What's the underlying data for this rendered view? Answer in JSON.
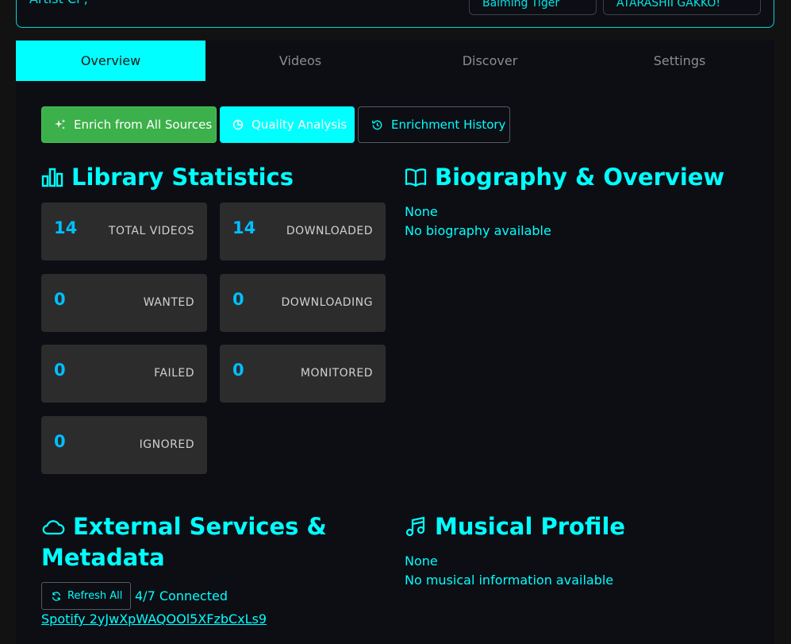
{
  "header": {
    "title_fragment": "Artist Ci  ;",
    "buttons": [
      "Balming Tiger",
      "ATARASHII GAKKO!"
    ]
  },
  "tabs": [
    {
      "label": "Overview",
      "active": true
    },
    {
      "label": "Videos",
      "active": false
    },
    {
      "label": "Discover",
      "active": false
    },
    {
      "label": "Settings",
      "active": false
    }
  ],
  "actions": {
    "enrich": "Enrich from All Sources",
    "quality": "Quality Analysis",
    "history": "Enrichment History"
  },
  "library": {
    "title": "Library Statistics",
    "stats": [
      {
        "value": "14",
        "label": "TOTAL VIDEOS"
      },
      {
        "value": "14",
        "label": "DOWNLOADED"
      },
      {
        "value": "0",
        "label": "WANTED"
      },
      {
        "value": "0",
        "label": "DOWNLOADING"
      },
      {
        "value": "0",
        "label": "FAILED"
      },
      {
        "value": "0",
        "label": "MONITORED"
      },
      {
        "value": "0",
        "label": "IGNORED"
      }
    ]
  },
  "biography": {
    "title": "Biography & Overview",
    "line1": "None",
    "line2": "No biography available"
  },
  "external": {
    "title_line1": "External Services &",
    "title_line2": "Metadata",
    "refresh": "Refresh All",
    "connected": "4/7 Connected",
    "spotify_label": "Spotify",
    "spotify_id": "2yJwXpWAQOOl5XFzbCxLs9"
  },
  "musical": {
    "title": "Musical Profile",
    "line1": "None",
    "line2": "No musical information available"
  },
  "colors": {
    "accent": "#00ffff",
    "green": "#3cb04a",
    "stat_number": "#00bfff",
    "card_bg": "#2c2c2c"
  }
}
